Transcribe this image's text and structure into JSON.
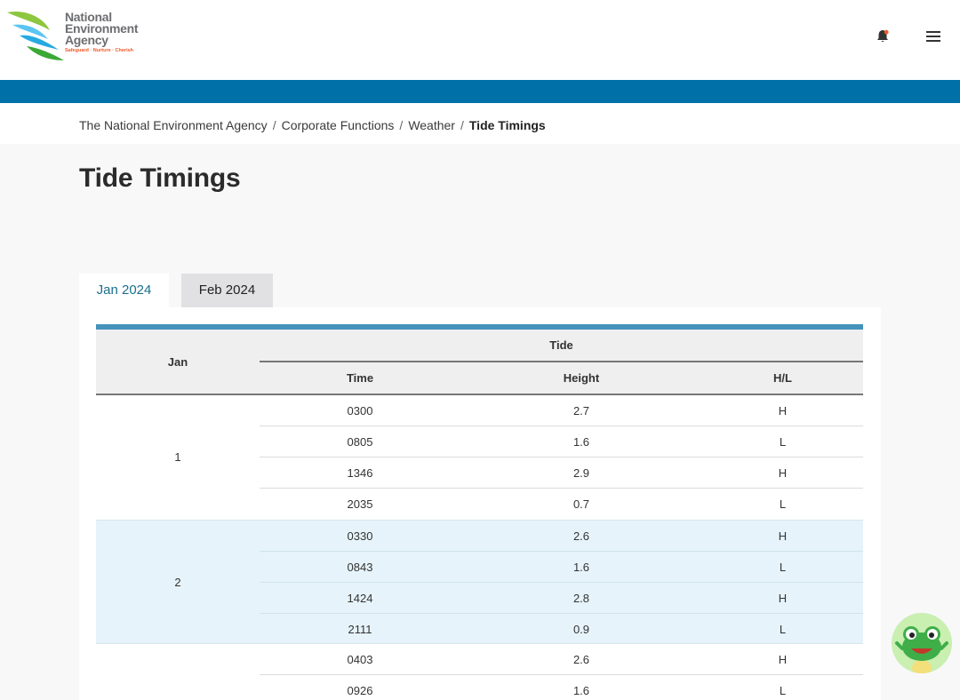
{
  "header": {
    "logo_lines": [
      "National",
      "Environment",
      "Agency"
    ],
    "logo_tagline": "Safeguard · Nurture · Cherish",
    "icons": [
      "bell-icon",
      "hamburger-menu-icon"
    ]
  },
  "breadcrumb": {
    "items": [
      "The National Environment Agency",
      "Corporate Functions",
      "Weather"
    ],
    "current": "Tide Timings"
  },
  "page": {
    "title": "Tide Timings"
  },
  "tabs": [
    {
      "label": "Jan 2024",
      "active": true
    },
    {
      "label": "Feb 2024",
      "active": false
    }
  ],
  "table": {
    "col_month": "Jan",
    "col_group": "Tide",
    "col_time": "Time",
    "col_height": "Height",
    "col_hl": "H/L",
    "days": [
      {
        "day": "1",
        "rows": [
          {
            "time": "0300",
            "height": "2.7",
            "hl": "H"
          },
          {
            "time": "0805",
            "height": "1.6",
            "hl": "L"
          },
          {
            "time": "1346",
            "height": "2.9",
            "hl": "H"
          },
          {
            "time": "2035",
            "height": "0.7",
            "hl": "L"
          }
        ]
      },
      {
        "day": "2",
        "rows": [
          {
            "time": "0330",
            "height": "2.6",
            "hl": "H"
          },
          {
            "time": "0843",
            "height": "1.6",
            "hl": "L"
          },
          {
            "time": "1424",
            "height": "2.8",
            "hl": "H"
          },
          {
            "time": "2111",
            "height": "0.9",
            "hl": "L"
          }
        ]
      },
      {
        "day": "",
        "rows": [
          {
            "time": "0403",
            "height": "2.6",
            "hl": "H"
          },
          {
            "time": "0926",
            "height": "1.6",
            "hl": "L"
          }
        ]
      }
    ]
  },
  "colors": {
    "brand_blue": "#0070a8",
    "table_accent": "#4592ba",
    "row_highlight": "#e6f3fa",
    "tab_active_text": "#1a6f8c"
  }
}
